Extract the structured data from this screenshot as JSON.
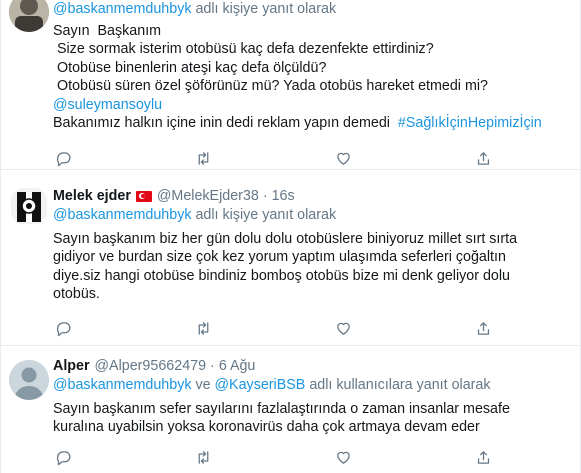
{
  "tweets": [
    {
      "reply_handle": "@baskanmemduhbyk",
      "reply_suffix": " adlı kişiye yanıt olarak",
      "lines": [
        "Sayın  Başkanım",
        " Size sormak isterim otobüsü kaç defa dezenfekte ettirdiniz?",
        " Otobüse binenlerin ateşi kaç defa ölçüldü?",
        " Otobüsü süren özel şöförünüz mü? Yada otobüs hareket etmedi mi?"
      ],
      "mention": "@suleymansoylu",
      "last_text": "Bakanımız halkın içine inin dedi reklam yapın demedi  ",
      "hashtag": "#SağlıkİçinHepimizİçin"
    },
    {
      "name": "Melek ejder",
      "handle": "@MelekEjder38",
      "dot": "·",
      "time": "16s",
      "reply_handle": "@baskanmemduhbyk",
      "reply_suffix": " adlı kişiye yanıt olarak",
      "lines": [
        "Sayın başkanım biz her gün dolu dolu otobüslere biniyoruz millet sırt sırta",
        "gidiyor ve burdan size çok kez yorum yaptım ulaşımda seferleri çoğaltın",
        "diye.siz hangi otobüse bindiniz bomboş otobüs bize mi denk geliyor dolu",
        "otobüs."
      ]
    },
    {
      "name": "Alper",
      "handle": "@Alper95662479",
      "dot": "·",
      "time": "6 Ağu",
      "reply_handle": "@baskanmemduhbyk",
      "reply_mid": " ve ",
      "reply_handle2": "@KayseriBSB",
      "reply_suffix": " adlı kullanıcılara yanıt olarak",
      "lines": [
        "Sayın başkanım sefer sayılarını fazlalaştırında o zaman insanlar mesafe",
        "kuralına uyabilsin yoksa koronavirüs daha çok artmaya devam eder"
      ]
    }
  ],
  "icons": [
    "reply-icon",
    "retweet-icon",
    "like-icon",
    "share-icon"
  ]
}
